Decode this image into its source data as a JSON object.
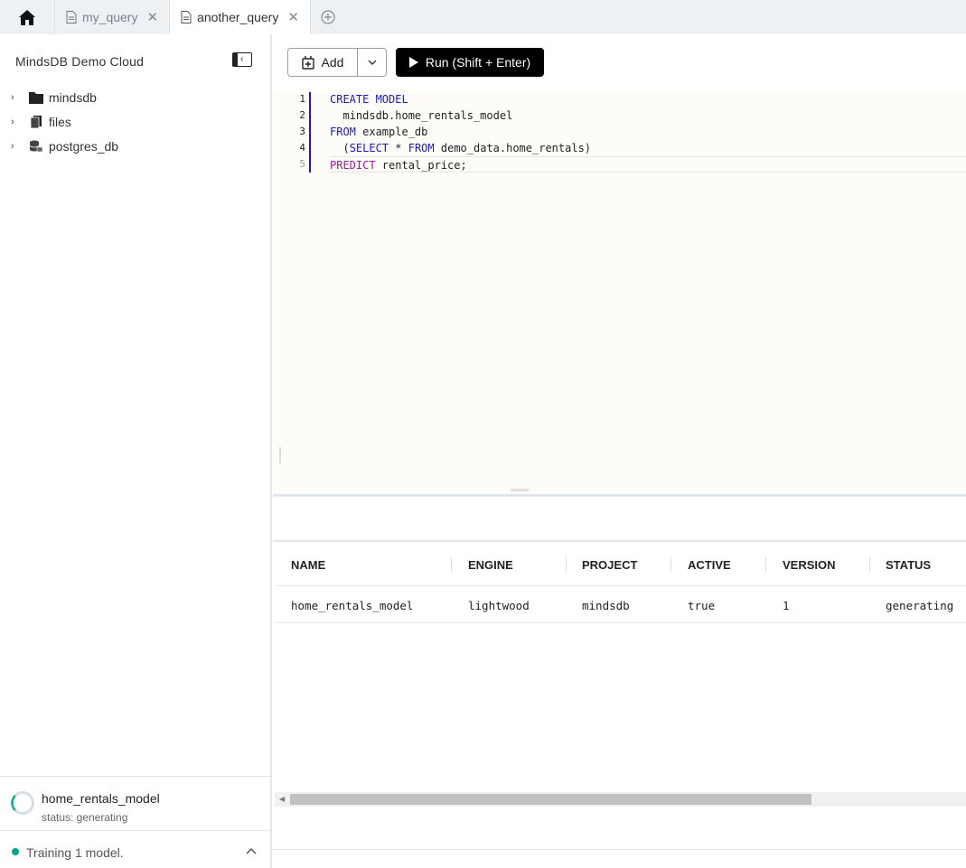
{
  "tabs": [
    {
      "label": "my_query"
    },
    {
      "label": "another_query"
    }
  ],
  "sidebar": {
    "title": "MindsDB Demo Cloud",
    "tree": [
      {
        "label": "mindsdb",
        "icon": "folder-icon"
      },
      {
        "label": "files",
        "icon": "files-icon"
      },
      {
        "label": "postgres_db",
        "icon": "database-icon"
      }
    ],
    "model": {
      "name": "home_rentals_model",
      "status": "status: generating"
    },
    "training": "Training 1 model."
  },
  "toolbar": {
    "add_label": "Add",
    "run_label": "Run (Shift + Enter)"
  },
  "editor": {
    "line_numbers": [
      "1",
      "2",
      "3",
      "4",
      "5"
    ],
    "code": {
      "l1_kw": "CREATE MODEL",
      "l2": "  mindsdb.home_rentals_model",
      "l3_kw": "FROM",
      "l3": " example_db",
      "l4_a": "  (",
      "l4_kw1": "SELECT",
      "l4_b": " * ",
      "l4_kw2": "FROM",
      "l4_c": " demo_data.home_rentals)",
      "l5_kw": "PREDICT",
      "l5": " rental_price;"
    }
  },
  "results": {
    "columns": [
      "NAME",
      "ENGINE",
      "PROJECT",
      "ACTIVE",
      "VERSION",
      "STATUS"
    ],
    "rows": [
      [
        "home_rentals_model",
        "lightwood",
        "mindsdb",
        "true",
        "1",
        "generating"
      ]
    ]
  },
  "colors": {
    "accent_blue": "#1a1ab8",
    "keyword_purple": "#9a1aa0",
    "status_green": "#00a587"
  }
}
